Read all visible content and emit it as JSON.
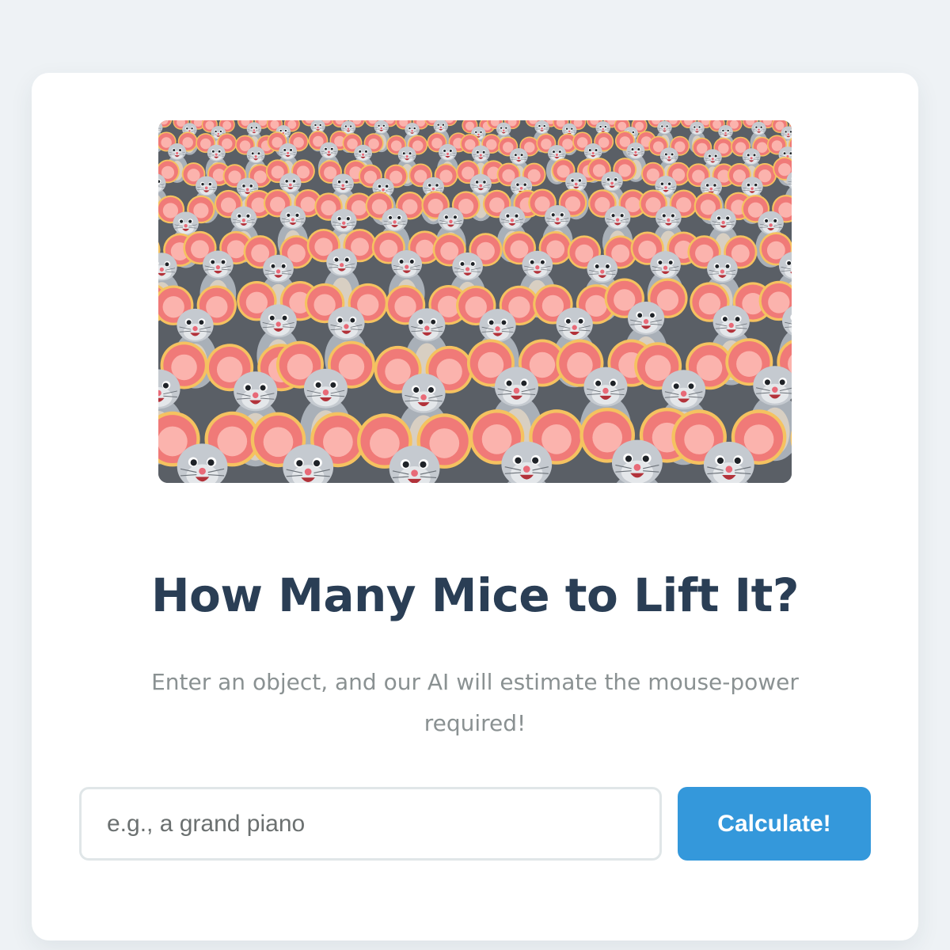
{
  "hero": {
    "subject": "crowd of cartoon mice",
    "colors": {
      "fur": "#c5cad0",
      "ear": "#f07a78",
      "ear_rim": "#f5c260",
      "background": "#5a5f66"
    }
  },
  "page": {
    "title": "How Many Mice to Lift It?",
    "subtitle": "Enter an object, and our AI will estimate the mouse-power required!"
  },
  "form": {
    "input_value": "",
    "input_placeholder": "e.g., a grand piano",
    "button_label": "Calculate!"
  },
  "colors": {
    "page_background": "#eef2f5",
    "card_background": "#ffffff",
    "title": "#2a3e55",
    "subtitle": "#8a9192",
    "button": "#3498db",
    "button_text": "#ffffff",
    "input_border": "#e0e6e8"
  }
}
